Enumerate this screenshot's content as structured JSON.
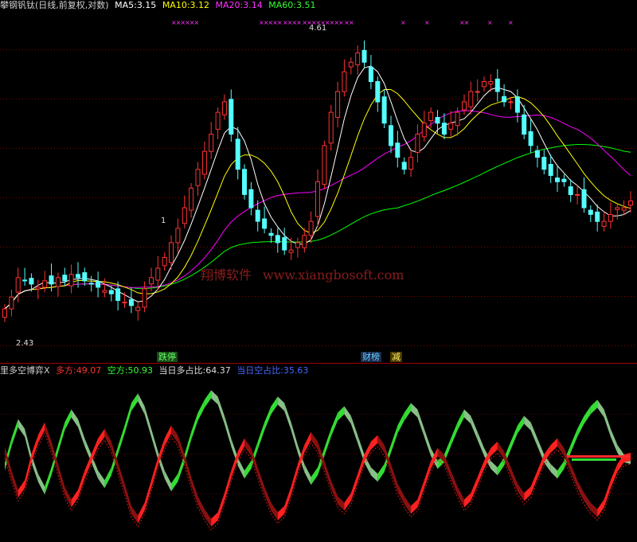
{
  "header": {
    "title": "攀钢钒钛(日线,前复权,对数)",
    "ma5": {
      "label": "MA5:",
      "value": "3.15",
      "color": "#ffffff"
    },
    "ma10": {
      "label": "MA10:",
      "value": "3.12",
      "color": "#ffff00"
    },
    "ma20": {
      "label": "MA20:",
      "value": "3.14",
      "color": "#ff00ff"
    },
    "ma60": {
      "label": "MA60:",
      "value": "3.51",
      "color": "#00ff00"
    }
  },
  "indicator": {
    "title": "里多空博弈X",
    "long": {
      "label": "多方:",
      "value": "49.07"
    },
    "short": {
      "label": "空方:",
      "value": "50.93"
    },
    "day_long": {
      "label": "当日多占比:",
      "value": "64.37"
    },
    "day_short": {
      "label": "当日空占比:",
      "value": "35.63"
    }
  },
  "watermark": {
    "cn": "翔博软件",
    "url": "www.xiangbosoft.com"
  },
  "tags": {
    "limit_down": "跌停",
    "finance": "财榜",
    "reduce": "减"
  },
  "event_marks": [
    "××××××",
    "×××××  ××××  ×××××××××  ××",
    "×",
    "×",
    "××",
    "×",
    "×"
  ],
  "chart_data": {
    "type": "candlestick",
    "title": "攀钢钒钛(日线,前复权,对数)",
    "scale": "log",
    "price_range": [
      2.2,
      4.9
    ],
    "annotations": [
      {
        "text": "4.61",
        "type": "high"
      },
      {
        "text": "2.43",
        "type": "low"
      },
      {
        "text": "1",
        "type": "mark"
      }
    ],
    "closes": [
      2.43,
      2.5,
      2.62,
      2.6,
      2.58,
      2.56,
      2.6,
      2.58,
      2.62,
      2.6,
      2.64,
      2.62,
      2.6,
      2.58,
      2.56,
      2.54,
      2.52,
      2.48,
      2.47,
      2.45,
      2.44,
      2.55,
      2.62,
      2.68,
      2.75,
      2.85,
      2.95,
      3.1,
      3.25,
      3.4,
      3.55,
      3.7,
      3.9,
      4.0,
      3.7,
      3.4,
      3.2,
      3.1,
      3.0,
      2.95,
      2.9,
      2.85,
      2.8,
      2.8,
      2.85,
      2.9,
      3.0,
      3.3,
      3.6,
      3.9,
      4.1,
      4.3,
      4.4,
      4.5,
      4.4,
      4.2,
      4.0,
      3.8,
      3.6,
      3.5,
      3.4,
      3.5,
      3.7,
      3.8,
      3.9,
      3.8,
      3.7,
      3.8,
      3.9,
      4.0,
      4.1,
      4.1,
      4.2,
      4.2,
      4.1,
      4.0,
      4.0,
      3.9,
      3.7,
      3.6,
      3.5,
      3.4,
      3.35,
      3.3,
      3.3,
      3.2,
      3.2,
      3.1,
      3.05,
      3.0,
      3.0,
      3.05,
      3.1,
      3.1,
      3.15
    ],
    "ma": [
      {
        "name": "MA5",
        "value": 3.15,
        "color": "#ffffff"
      },
      {
        "name": "MA10",
        "value": 3.12,
        "color": "#ffff00"
      },
      {
        "name": "MA20",
        "value": 3.14,
        "color": "#ff00ff"
      },
      {
        "name": "MA60",
        "value": 3.51,
        "color": "#00ff00"
      }
    ],
    "indicator": {
      "name": "里多空博弈X",
      "long_value": 49.07,
      "short_value": 50.93,
      "day_long_pct": 64.37,
      "day_short_pct": 35.63,
      "long_series": [
        45,
        60,
        72,
        66,
        50,
        38,
        30,
        42,
        56,
        70,
        78,
        72,
        60,
        50,
        40,
        34,
        42,
        55,
        68,
        82,
        88,
        80,
        66,
        52,
        40,
        32,
        38,
        50,
        64,
        76,
        84,
        90,
        86,
        74,
        60,
        48,
        40,
        46,
        58,
        70,
        80,
        86,
        82,
        70,
        56,
        44,
        36,
        42,
        54,
        66,
        76,
        80,
        74,
        62,
        50,
        42,
        38,
        44,
        56,
        68,
        76,
        82,
        78,
        66,
        54,
        46,
        50,
        60,
        70,
        78,
        74,
        64,
        54,
        46,
        42,
        48,
        58,
        68,
        74,
        70,
        60,
        50,
        44,
        40,
        46,
        56,
        66,
        74,
        80,
        84,
        78,
        66,
        56,
        50,
        49
      ],
      "short_series": [
        55,
        40,
        28,
        34,
        50,
        62,
        70,
        58,
        44,
        30,
        22,
        28,
        40,
        50,
        60,
        66,
        58,
        45,
        32,
        18,
        12,
        20,
        34,
        48,
        60,
        68,
        62,
        50,
        36,
        24,
        16,
        10,
        14,
        26,
        40,
        52,
        60,
        54,
        42,
        30,
        20,
        14,
        18,
        30,
        44,
        56,
        64,
        58,
        46,
        34,
        24,
        20,
        26,
        38,
        50,
        58,
        62,
        56,
        44,
        32,
        24,
        18,
        22,
        34,
        46,
        54,
        50,
        40,
        30,
        22,
        26,
        36,
        46,
        54,
        58,
        52,
        42,
        32,
        26,
        30,
        40,
        50,
        56,
        60,
        54,
        44,
        34,
        26,
        20,
        16,
        22,
        34,
        44,
        50,
        51
      ]
    }
  }
}
